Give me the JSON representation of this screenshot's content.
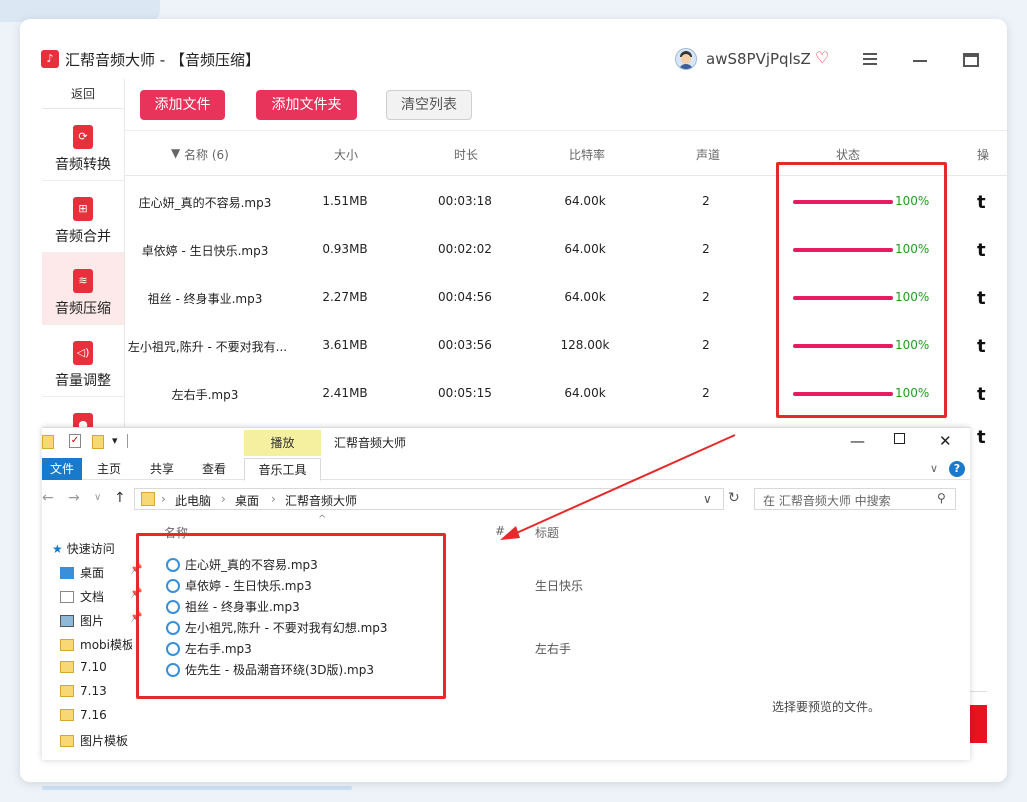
{
  "app": {
    "title": "汇帮音频大师 - 【音频压缩】",
    "user_name": "awS8PVjPqlsZ"
  },
  "sidebar": {
    "back_label": "返回",
    "items": [
      {
        "label": "音频转换",
        "icon": "convert-icon"
      },
      {
        "label": "音频合并",
        "icon": "merge-icon"
      },
      {
        "label": "音频压缩",
        "icon": "compress-icon",
        "active": true
      },
      {
        "label": "音量调整",
        "icon": "volume-icon"
      }
    ]
  },
  "toolbar": {
    "add_file": "添加文件",
    "add_folder": "添加文件夹",
    "clear_list": "清空列表"
  },
  "table": {
    "headers": {
      "name": "名称 (6)",
      "size": "大小",
      "duration": "时长",
      "bitrate": "比特率",
      "channels": "声道",
      "status": "状态",
      "ops": "操"
    },
    "rows": [
      {
        "name": "庄心妍_真的不容易.mp3",
        "size": "1.51MB",
        "duration": "00:03:18",
        "bitrate": "64.00k",
        "channels": "2",
        "progress": 100,
        "status": "100%"
      },
      {
        "name": "卓依婷 - 生日快乐.mp3",
        "size": "0.93MB",
        "duration": "00:02:02",
        "bitrate": "64.00k",
        "channels": "2",
        "progress": 100,
        "status": "100%"
      },
      {
        "name": "祖丝 - 终身事业.mp3",
        "size": "2.27MB",
        "duration": "00:04:56",
        "bitrate": "64.00k",
        "channels": "2",
        "progress": 100,
        "status": "100%"
      },
      {
        "name": "左小祖咒,陈升 - 不要对我有...",
        "size": "3.61MB",
        "duration": "00:03:56",
        "bitrate": "128.00k",
        "channels": "2",
        "progress": 100,
        "status": "100%"
      },
      {
        "name": "左右手.mp3",
        "size": "2.41MB",
        "duration": "00:05:15",
        "bitrate": "64.00k",
        "channels": "2",
        "progress": 100,
        "status": "100%"
      }
    ]
  },
  "explorer": {
    "play_tab": "播放",
    "title": "汇帮音频大师",
    "ribbon": [
      "文件",
      "主页",
      "共享",
      "查看",
      "音乐工具"
    ],
    "breadcrumb": [
      "此电脑",
      "桌面",
      "汇帮音频大师"
    ],
    "search_placeholder": "在 汇帮音频大师 中搜索",
    "nav": [
      "快速访问",
      "桌面",
      "文档",
      "图片",
      "mobi模板",
      "7.10",
      "7.13",
      "7.16",
      "图片模板"
    ],
    "col_name": "名称",
    "col_hash": "#",
    "col_title": "标题",
    "files": [
      {
        "name": "庄心妍_真的不容易.mp3",
        "title": ""
      },
      {
        "name": "卓依婷 - 生日快乐.mp3",
        "title": "生日快乐"
      },
      {
        "name": "祖丝 - 终身事业.mp3",
        "title": ""
      },
      {
        "name": "左小祖咒,陈升 - 不要对我有幻想.mp3",
        "title": ""
      },
      {
        "name": "左右手.mp3",
        "title": "左右手"
      },
      {
        "name": "佐先生 - 极品潮音环绕(3D版).mp3",
        "title": ""
      }
    ],
    "preview_hint": "选择要预览的文件。"
  },
  "colors": {
    "brand_red": "#e6313d",
    "progress": "#e61c63",
    "status_green": "#1fa01f",
    "highlight": "#e52a2a"
  }
}
